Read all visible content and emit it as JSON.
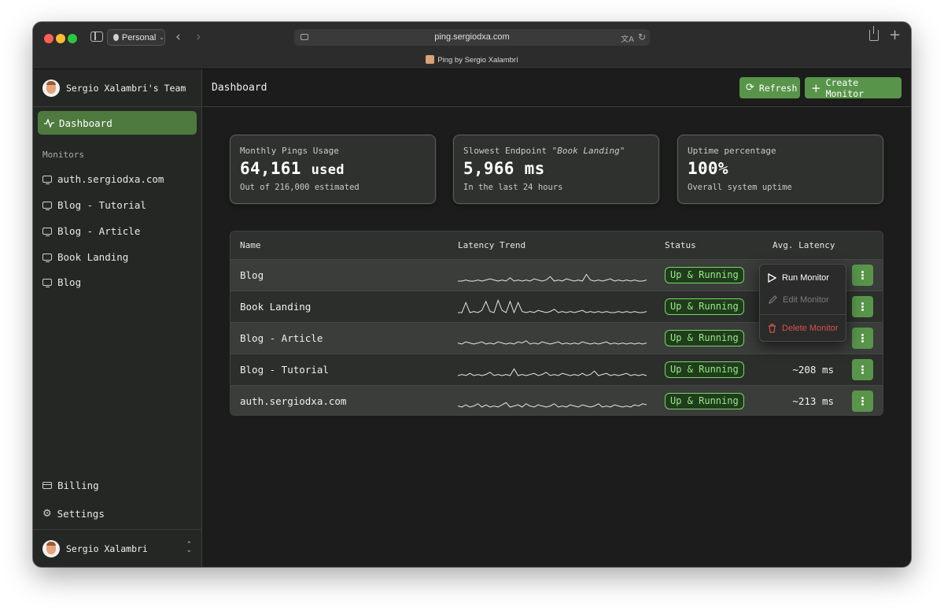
{
  "browser": {
    "profile": "Personal",
    "url": "ping.sergiodxa.com",
    "tab_title": "Ping by Sergio Xalambrí",
    "icons": [
      "sidebar-icon",
      "person-icon",
      "back-icon",
      "forward-icon",
      "translate-icon",
      "reload-icon",
      "share-icon",
      "plus-icon"
    ]
  },
  "sidebar": {
    "team_name": "Sergio Xalambri's Team",
    "nav": {
      "dashboard": "Dashboard"
    },
    "monitors_label": "Monitors",
    "monitors": [
      "auth.sergiodxa.com",
      "Blog - Tutorial",
      "Blog - Article",
      "Book Landing",
      "Blog"
    ],
    "billing": "Billing",
    "settings": "Settings",
    "user_name": "Sergio Xalambri"
  },
  "header": {
    "title": "Dashboard",
    "refresh": "Refresh",
    "create": "Create Monitor"
  },
  "stats": [
    {
      "label": "Monthly Pings Usage",
      "value": "64,161",
      "unit": "used",
      "sub": "Out of 216,000 estimated"
    },
    {
      "label_prefix": "Slowest Endpoint \"",
      "label_em": "Book Landing",
      "label_suffix": "\"",
      "value": "5,966",
      "unit": "ms",
      "sub": "In the last 24 hours"
    },
    {
      "label": "Uptime percentage",
      "value": "100%",
      "unit": "",
      "sub": "Overall system uptime"
    }
  ],
  "table": {
    "headers": [
      "Name",
      "Latency Trend",
      "Status",
      "Avg. Latency"
    ],
    "rows": [
      {
        "name": "Blog",
        "status": "Up & Running",
        "latency": "",
        "trend": [
          0,
          0,
          1,
          0,
          0,
          1,
          0,
          1,
          2,
          1,
          0,
          1,
          0,
          3,
          0,
          1,
          0,
          1,
          0,
          2,
          1,
          0,
          1,
          4,
          0,
          1,
          0,
          2,
          1,
          0,
          1,
          0,
          6,
          1,
          0,
          1,
          0,
          1,
          2,
          0,
          1,
          0,
          1,
          0,
          1,
          0,
          0,
          1
        ]
      },
      {
        "name": "Book Landing",
        "status": "Up & Running",
        "latency": "",
        "trend": [
          0,
          0,
          9,
          0,
          1,
          0,
          2,
          10,
          1,
          0,
          11,
          2,
          0,
          10,
          0,
          9,
          1,
          0,
          1,
          0,
          2,
          1,
          0,
          1,
          3,
          0,
          1,
          0,
          1,
          0,
          1,
          2,
          0,
          1,
          0,
          1,
          0,
          1,
          0,
          0,
          1,
          0,
          1,
          0,
          1,
          0,
          0,
          1
        ]
      },
      {
        "name": "Blog - Article",
        "status": "Up & Running",
        "latency": "",
        "trend": [
          1,
          0,
          2,
          1,
          0,
          1,
          2,
          0,
          1,
          0,
          2,
          1,
          0,
          1,
          0,
          2,
          1,
          3,
          0,
          1,
          0,
          2,
          1,
          0,
          1,
          2,
          0,
          1,
          0,
          1,
          0,
          2,
          1,
          0,
          1,
          0,
          1,
          2,
          0,
          1,
          0,
          1,
          0,
          1,
          0,
          1,
          0,
          1
        ]
      },
      {
        "name": "Blog - Tutorial",
        "status": "Up & Running",
        "latency": "~208 ms",
        "trend": [
          0,
          1,
          0,
          2,
          0,
          1,
          0,
          1,
          3,
          0,
          1,
          0,
          1,
          0,
          6,
          0,
          1,
          0,
          1,
          2,
          0,
          1,
          3,
          0,
          1,
          0,
          2,
          1,
          0,
          1,
          0,
          2,
          0,
          1,
          4,
          0,
          1,
          2,
          0,
          1,
          0,
          1,
          2,
          0,
          1,
          0,
          1,
          0
        ]
      },
      {
        "name": "auth.sergiodxa.com",
        "status": "Up & Running",
        "latency": "~213 ms",
        "trend": [
          1,
          0,
          2,
          0,
          1,
          3,
          0,
          2,
          0,
          1,
          0,
          2,
          4,
          0,
          1,
          2,
          0,
          3,
          1,
          0,
          2,
          1,
          0,
          1,
          3,
          0,
          1,
          0,
          2,
          1,
          0,
          2,
          1,
          0,
          1,
          3,
          0,
          1,
          0,
          2,
          1,
          0,
          1,
          0,
          2,
          1,
          3,
          2
        ]
      }
    ]
  },
  "menu": {
    "run": "Run Monitor",
    "edit": "Edit Monitor",
    "delete": "Delete Monitor"
  },
  "colors": {
    "accent": "#58954a",
    "status_text": "#9ae88a",
    "danger": "#d9534f"
  }
}
